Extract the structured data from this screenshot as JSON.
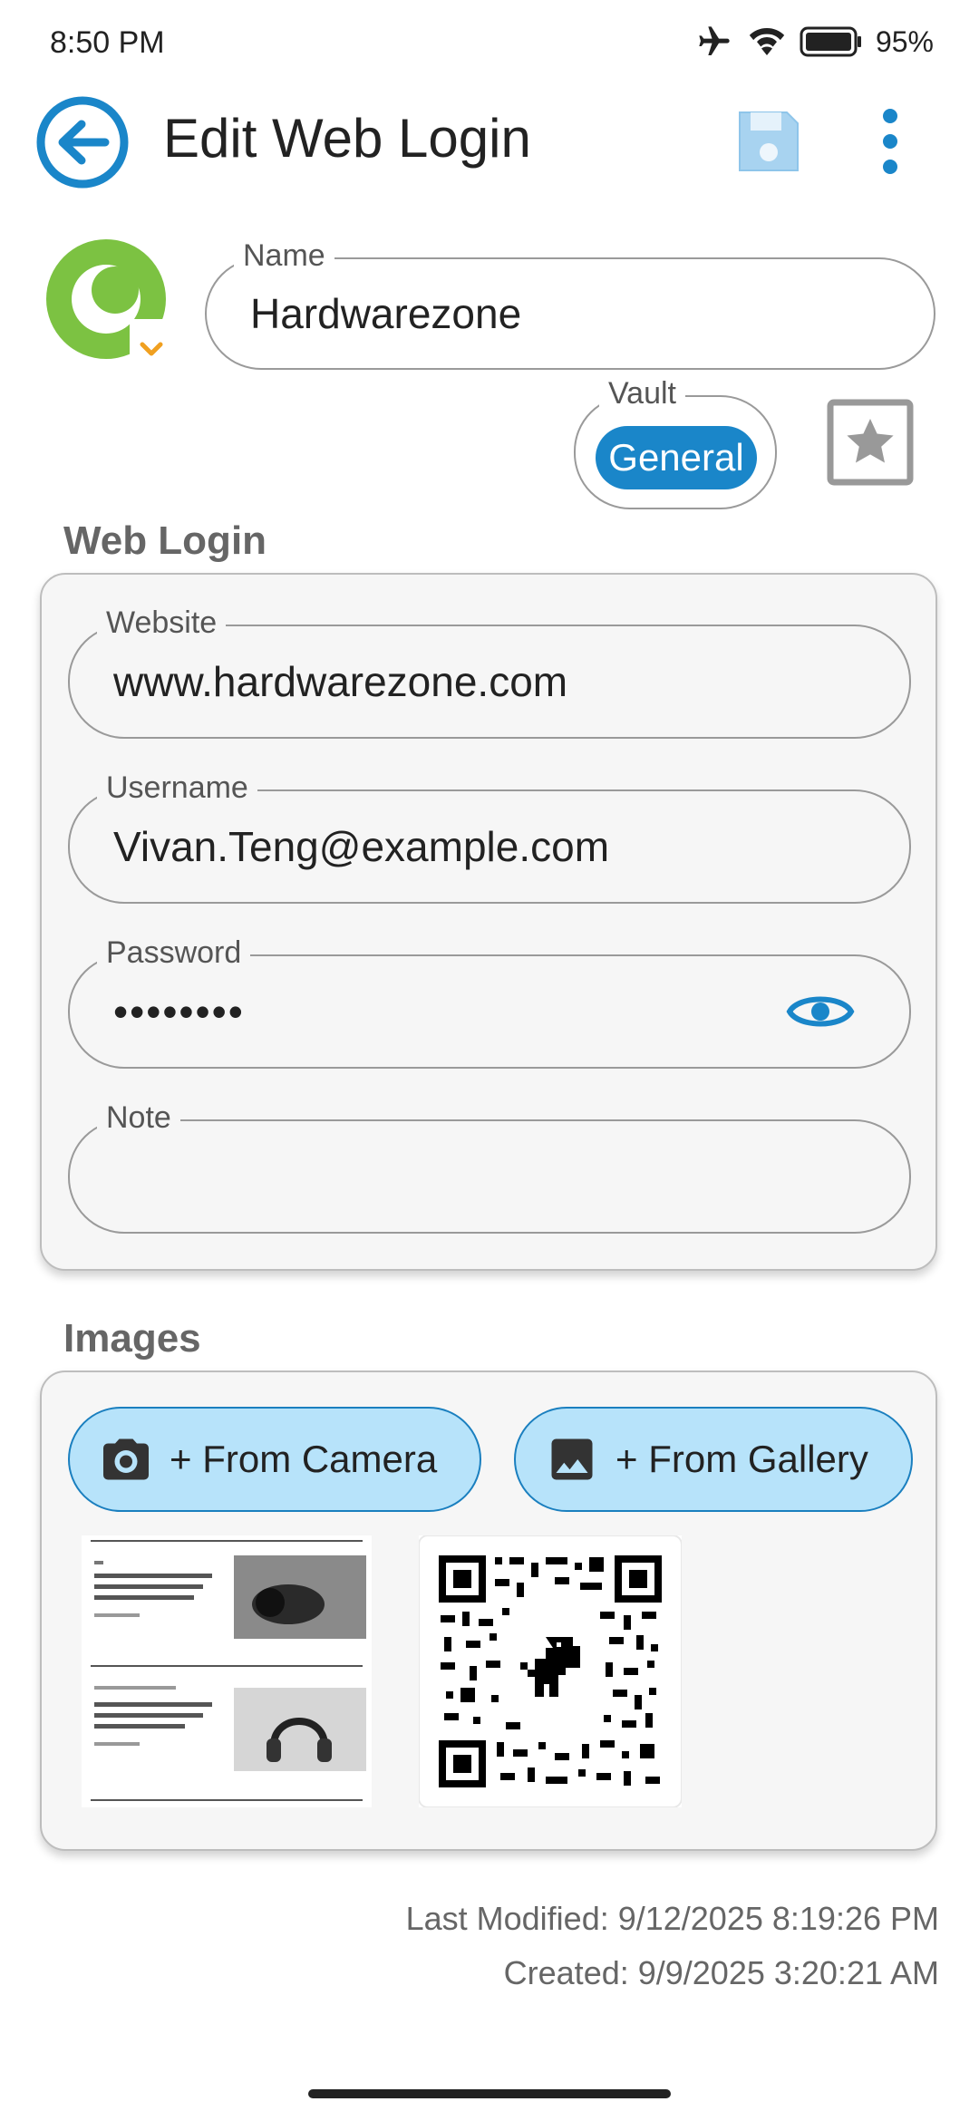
{
  "status_bar": {
    "time": "8:50 PM",
    "battery": "95%"
  },
  "app_bar": {
    "title": "Edit Web Login"
  },
  "entry": {
    "name_label": "Name",
    "name_value": "Hardwarezone",
    "vault_label": "Vault",
    "vault_value": "General"
  },
  "web_login": {
    "section_title": "Web Login",
    "website_label": "Website",
    "website_value": "www.hardwarezone.com",
    "username_label": "Username",
    "username_value": "Vivan.Teng@example.com",
    "password_label": "Password",
    "password_value": "••••••••",
    "note_label": "Note",
    "note_value": ""
  },
  "images": {
    "section_title": "Images",
    "camera_button": "+ From Camera",
    "gallery_button": "+ From Gallery"
  },
  "meta": {
    "last_modified": "Last Modified: 9/12/2025 8:19:26 PM",
    "created": "Created: 9/9/2025 3:20:21 AM"
  },
  "colors": {
    "accent": "#1a86c9",
    "button_fill": "#b7e3fa",
    "logo_green": "#7cc242",
    "logo_orange": "#f0a020"
  }
}
